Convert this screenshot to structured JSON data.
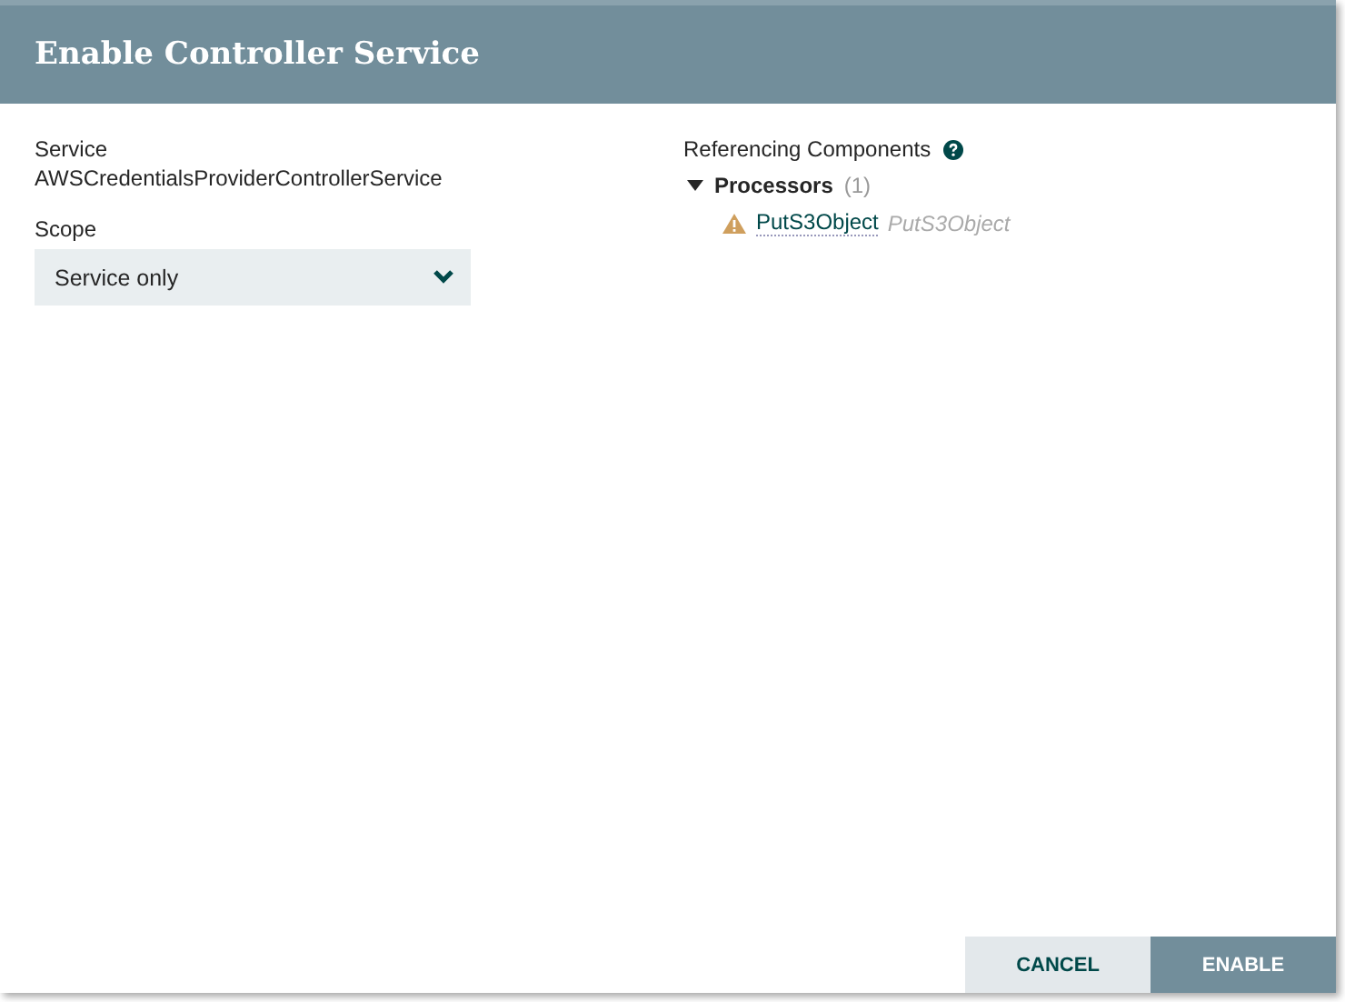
{
  "dialog": {
    "title": "Enable Controller Service"
  },
  "service": {
    "label": "Service",
    "value": "AWSCredentialsProviderControllerService"
  },
  "scope": {
    "label": "Scope",
    "value": "Service only"
  },
  "referencing": {
    "title": "Referencing Components",
    "groups": [
      {
        "name": "Processors",
        "count": "(1)",
        "expanded": true,
        "items": [
          {
            "kind": "warning",
            "name": "PutS3Object",
            "type": "PutS3Object"
          }
        ]
      }
    ]
  },
  "buttons": [
    {
      "label": "CANCEL",
      "kind": "secondary"
    },
    {
      "label": "ENABLE",
      "kind": "primary"
    }
  ]
}
